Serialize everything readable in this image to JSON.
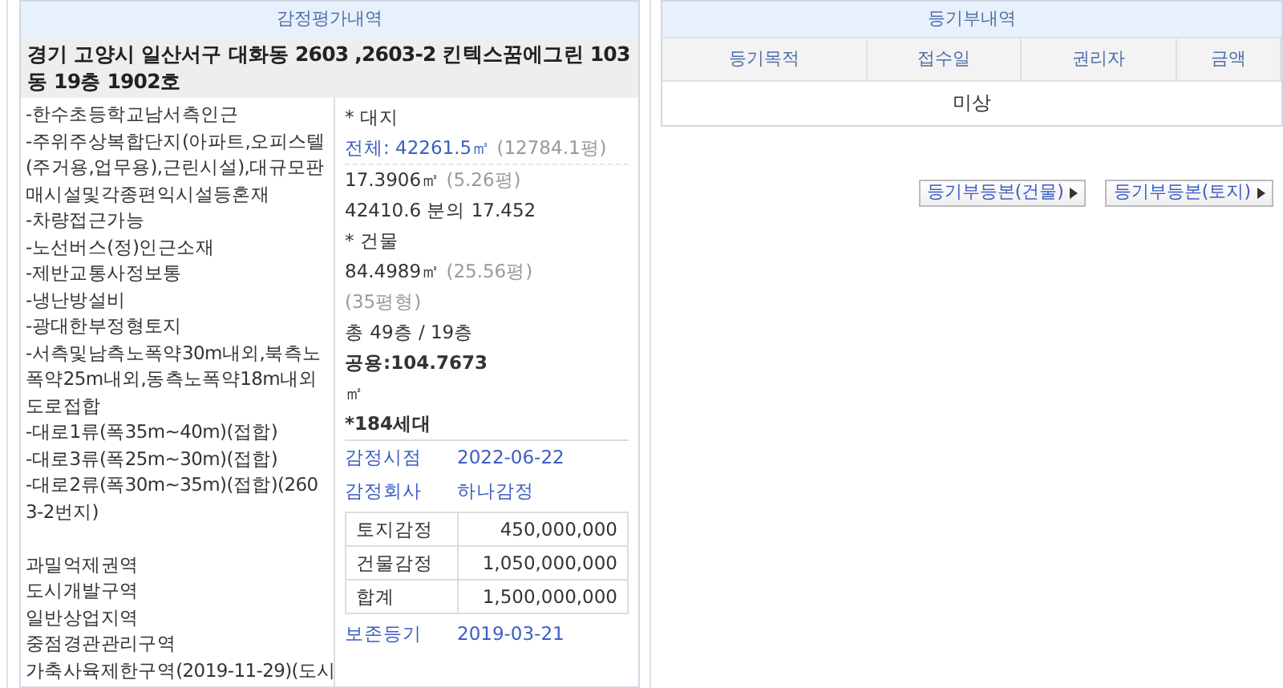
{
  "appraisal": {
    "title": "감정평가내역",
    "address": "경기 고양시 일산서구 대화동 2603 ,2603-2 킨텍스꿈에그린 103동 19층 1902호",
    "features": [
      "-한수초등학교남서측인근",
      "-주위주상복합단지(아파트,오피스텔(주거용,업무용),근린시설),대규모판매시설및각종편익시설등혼재",
      "-차량접근가능",
      "-노선버스(정)인근소재",
      "-제반교통사정보통",
      "-냉난방설비",
      "-광대한부정형토지",
      "-서측및남측노폭약30m내외,북측노폭약25m내외,동측노폭약18m내외도로접합",
      "-대로1류(폭35m~40m)(접합)",
      "-대로3류(폭25m~30m)(접합)",
      "-대로2류(폭30m~35m)(접합)(2603-2번지)"
    ],
    "zoning": [
      "과밀억제권역",
      "도시개발구역",
      "일반상업지역",
      "중점경관관리구역",
      "가축사육제한구역(2019-11-29)(도시"
    ],
    "land": {
      "label": "* 대지",
      "total": "전체: 42261.5㎡",
      "total_pyeong": "(12784.1평)",
      "area": "17.3906㎡",
      "area_pyeong": "(5.26평)",
      "share": "42410.6 분의 17.452"
    },
    "building": {
      "label": "* 건물",
      "area": "84.4989㎡",
      "area_pyeong": "(25.56평)",
      "type": "(35평형)",
      "floors": "총 49층 / 19층",
      "common": "공용:104.7673",
      "common_unit": "㎡",
      "households": "*184세대"
    },
    "info": [
      {
        "label": "감정시점",
        "value": "2022-06-22"
      },
      {
        "label": "감정회사",
        "value": "하나감정"
      }
    ],
    "amounts": [
      {
        "label": "토지감정",
        "value": "450,000,000"
      },
      {
        "label": "건물감정",
        "value": "1,050,000,000"
      },
      {
        "label": "합계",
        "value": "1,500,000,000"
      }
    ],
    "registration": {
      "label": "보존등기",
      "value": "2019-03-21"
    }
  },
  "registry": {
    "title": "등기부내역",
    "columns": [
      "등기목적",
      "접수일",
      "권리자",
      "금액"
    ],
    "empty": "미상",
    "buttons": [
      "등기부등본(건물)",
      "등기부등본(토지)"
    ]
  }
}
